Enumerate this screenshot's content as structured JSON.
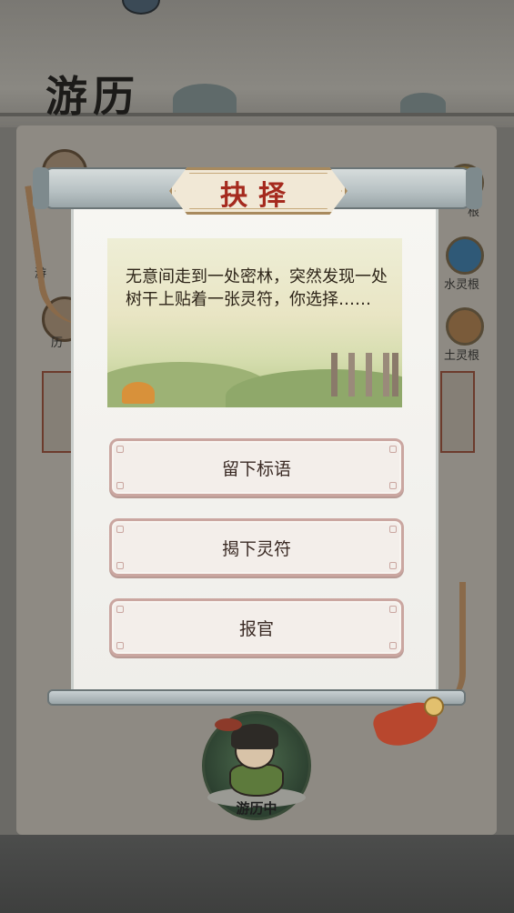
{
  "background": {
    "screen_title": "游历",
    "left_labels": [
      "游",
      "历"
    ],
    "right_labels": [
      "根",
      "水灵根",
      "土灵根"
    ]
  },
  "dialog": {
    "title": "抉择",
    "story_text": "无意间走到一处密林，突然发现一处树干上贴着一张灵符，你选择……",
    "choices": [
      {
        "label": "留下标语"
      },
      {
        "label": "揭下灵符"
      },
      {
        "label": "报官"
      }
    ]
  },
  "status": {
    "label": "游历中"
  },
  "colors": {
    "title_red": "#a52a1e",
    "button_border": "#caa6a0",
    "paper": "#f7f6f2",
    "tassel": "#b8472e"
  }
}
